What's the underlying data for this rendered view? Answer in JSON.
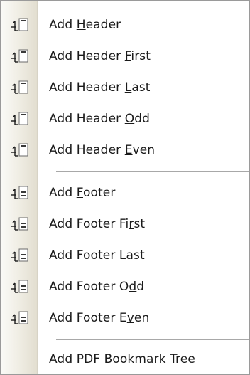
{
  "menu": {
    "items": [
      {
        "label": "Add Header",
        "pre": "Add ",
        "mn": "H",
        "post": "eader",
        "icon": "add-header-icon"
      },
      {
        "label": "Add Header First",
        "pre": "Add Header ",
        "mn": "F",
        "post": "irst",
        "icon": "add-header-icon"
      },
      {
        "label": "Add Header Last",
        "pre": "Add Header ",
        "mn": "L",
        "post": "ast",
        "icon": "add-header-icon"
      },
      {
        "label": "Add Header Odd",
        "pre": "Add Header ",
        "mn": "O",
        "post": "dd",
        "icon": "add-header-icon"
      },
      {
        "label": "Add Header Even",
        "pre": "Add Header ",
        "mn": "E",
        "post": "ven",
        "icon": "add-header-icon"
      },
      {
        "label": "Add Footer",
        "pre": "Add ",
        "mn": "F",
        "post": "ooter",
        "icon": "add-footer-icon"
      },
      {
        "label": "Add Footer First",
        "pre": "Add Footer Fi",
        "mn": "r",
        "post": "st",
        "icon": "add-footer-icon"
      },
      {
        "label": "Add Footer Last",
        "pre": "Add Footer L",
        "mn": "a",
        "post": "st",
        "icon": "add-footer-icon"
      },
      {
        "label": "Add Footer Odd",
        "pre": "Add Footer O",
        "mn": "d",
        "post": "d",
        "icon": "add-footer-icon"
      },
      {
        "label": "Add Footer Even",
        "pre": "Add Footer E",
        "mn": "v",
        "post": "en",
        "icon": "add-footer-icon"
      },
      {
        "label": "Add PDF Bookmark Tree",
        "pre": "Add ",
        "mn": "P",
        "post": "DF Bookmark Tree",
        "icon": ""
      }
    ]
  }
}
